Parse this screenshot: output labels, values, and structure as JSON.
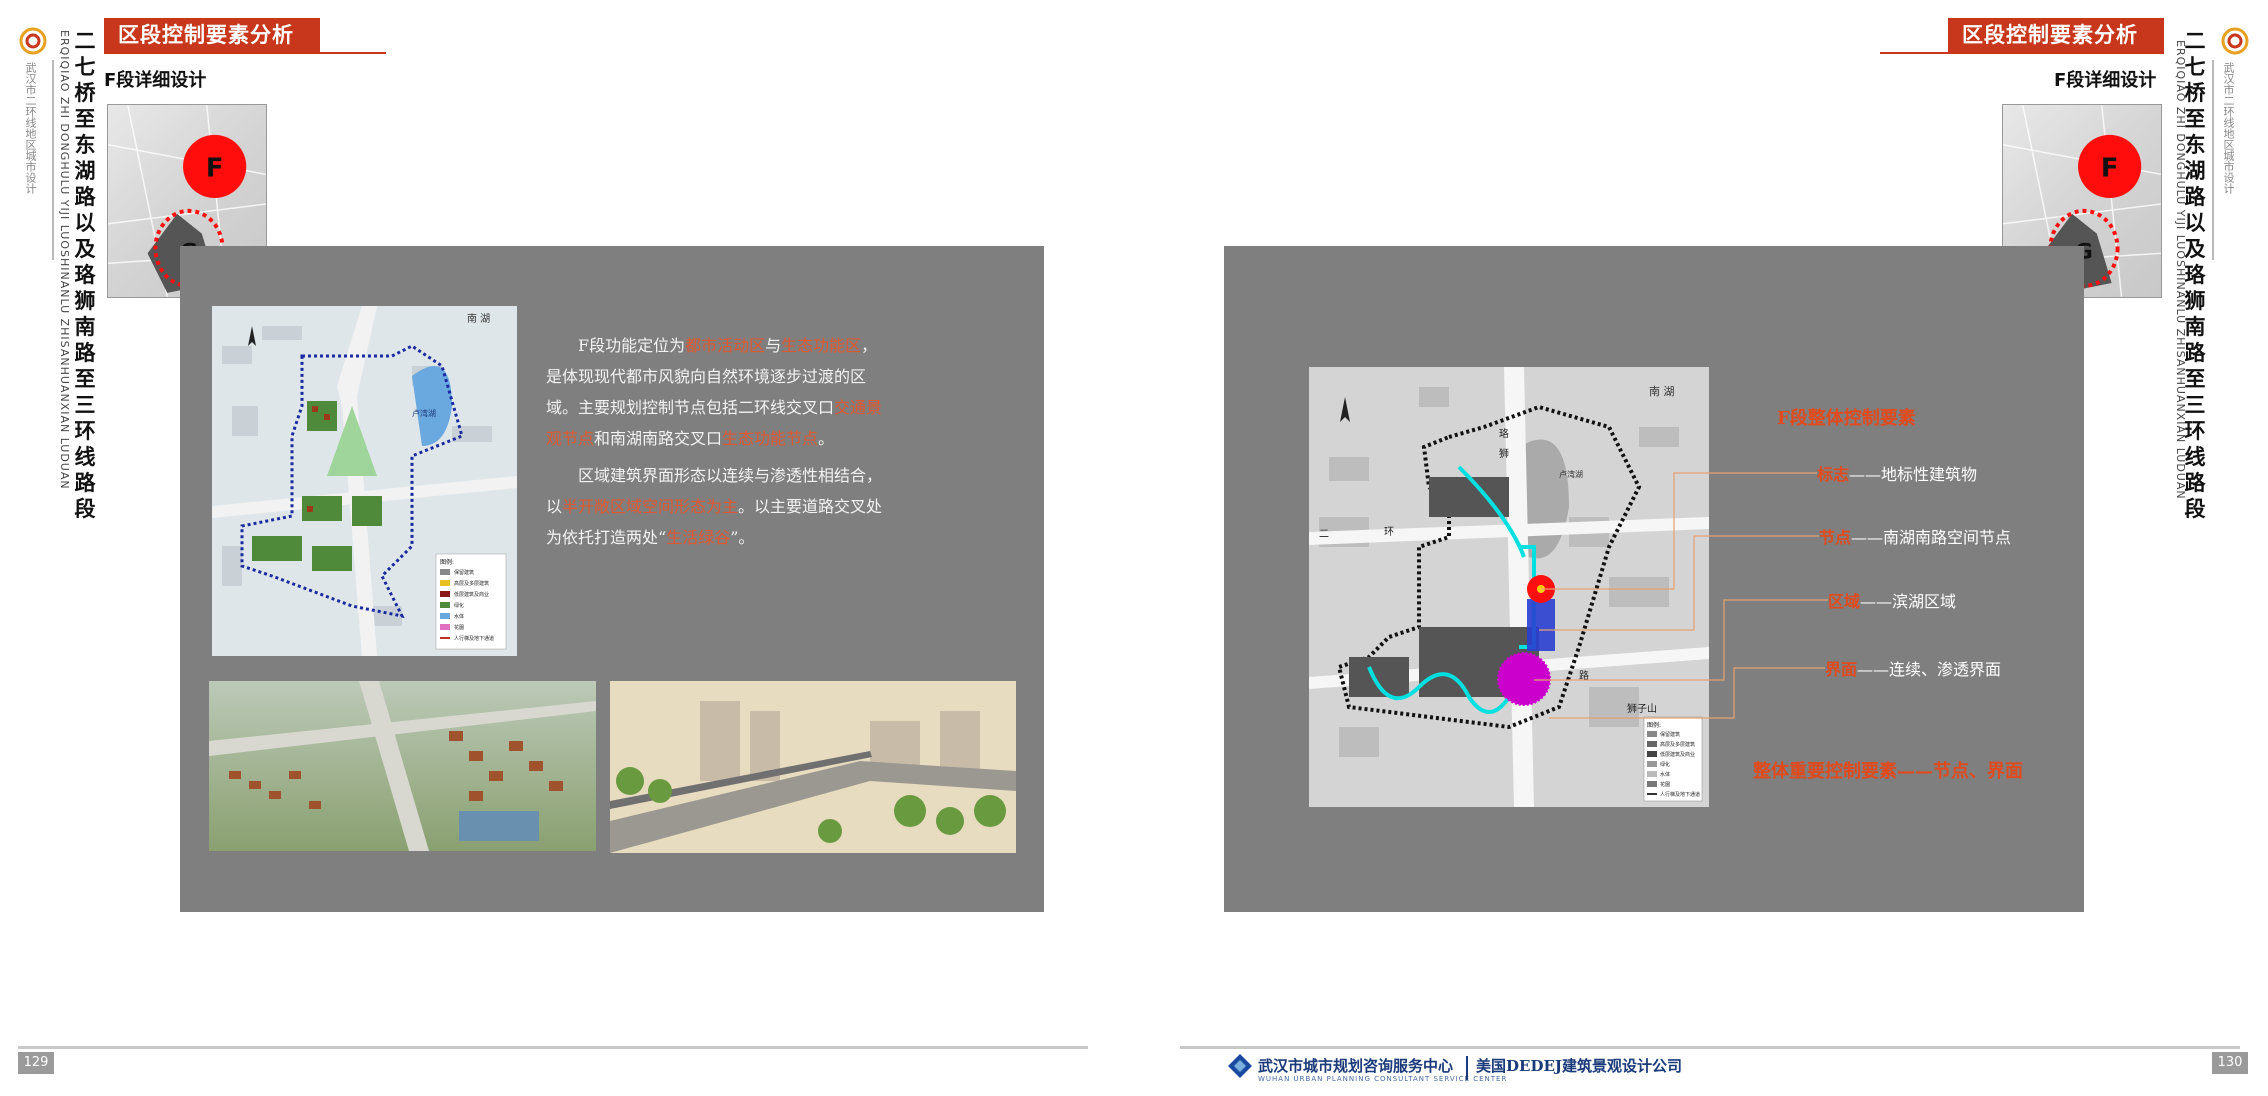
{
  "header": {
    "tab_label": "区段控制要素分析",
    "section_title": "F段详细设计"
  },
  "side": {
    "title_cn": "二七桥至东湖路以及珞狮南路至三环线路段",
    "title_en": "ERQIQIAO ZHI DONGHULU YIJI LUOSHINANLU ZHISANHUANXIAN LUDUAN",
    "org": "武汉市二环线地区城市设计",
    "logo_icon": "spiral-logo-icon"
  },
  "keymap": {
    "label_f": "F",
    "label_g": "G"
  },
  "left_page": {
    "page_number": "129",
    "map": {
      "label_lake": "南 湖",
      "label_bay": "卢湾湖",
      "legend_title": "图例:",
      "legend": [
        "保留建筑",
        "高层及多层建筑",
        "低层建筑及商业",
        "绿化",
        "水体",
        "花園",
        "人行梯及地下通道"
      ]
    },
    "paragraph1": [
      {
        "t": "F段功能定位为",
        "h": false
      },
      {
        "t": "都市活动区",
        "h": true
      },
      {
        "t": "与",
        "h": false
      },
      {
        "t": "生态功能区",
        "h": true
      },
      {
        "t": "，是体现现代都市风貌向自然环境逐步过渡的区域。主要规划控制节点包括二环线交叉口",
        "h": false
      },
      {
        "t": "交通景观节点",
        "h": true
      },
      {
        "t": "和南湖南路交叉口",
        "h": false
      },
      {
        "t": "生态功能节点",
        "h": true
      },
      {
        "t": "。",
        "h": false
      }
    ],
    "paragraph2": [
      {
        "t": "区域建筑界面形态以连续与渗透性相结合，以",
        "h": false
      },
      {
        "t": "半开敞区域空间形态为主",
        "h": true
      },
      {
        "t": "。以主要道路交叉处为依托打造两处“",
        "h": false
      },
      {
        "t": "生活绿谷",
        "h": true
      },
      {
        "t": "”。",
        "h": false
      }
    ]
  },
  "right_page": {
    "page_number": "130",
    "map": {
      "label_lake": "南 湖",
      "label_bay": "卢湾湖",
      "label_ring1": "二",
      "label_ring2": "环",
      "label_road1": "珞",
      "label_road2": "狮",
      "label_road3": "路",
      "label_hill": "狮子山",
      "legend_title": "图例:",
      "legend": [
        "保留建筑",
        "高层及多层建筑",
        "低层建筑及商业",
        "绿化",
        "水体",
        "花園",
        "人行梯及地下通道"
      ]
    },
    "control": {
      "title": "F段整体控制要素",
      "items": [
        {
          "key": "标志",
          "sep": "——",
          "value": "地标性建筑物"
        },
        {
          "key": "节点",
          "sep": "——",
          "value": "南湖南路空间节点"
        },
        {
          "key": "区域",
          "sep": "——",
          "value": "滨湖区域"
        },
        {
          "key": "界面",
          "sep": "——",
          "value": "连续、渗透界面"
        }
      ],
      "summary": "整体重要控制要素——节点、界面"
    },
    "footer": {
      "org_cn": "武汉市城市规划咨询服务中心",
      "org_en": "WUHAN URBAN PLANNING CONSULTANT SERVICE CENTER",
      "partner": "美国DEDEJ建筑景观设计公司"
    }
  },
  "colors": {
    "accent_red": "#c8371c",
    "highlight": "#e2572e",
    "panel_gray": "#7f7f7f"
  }
}
